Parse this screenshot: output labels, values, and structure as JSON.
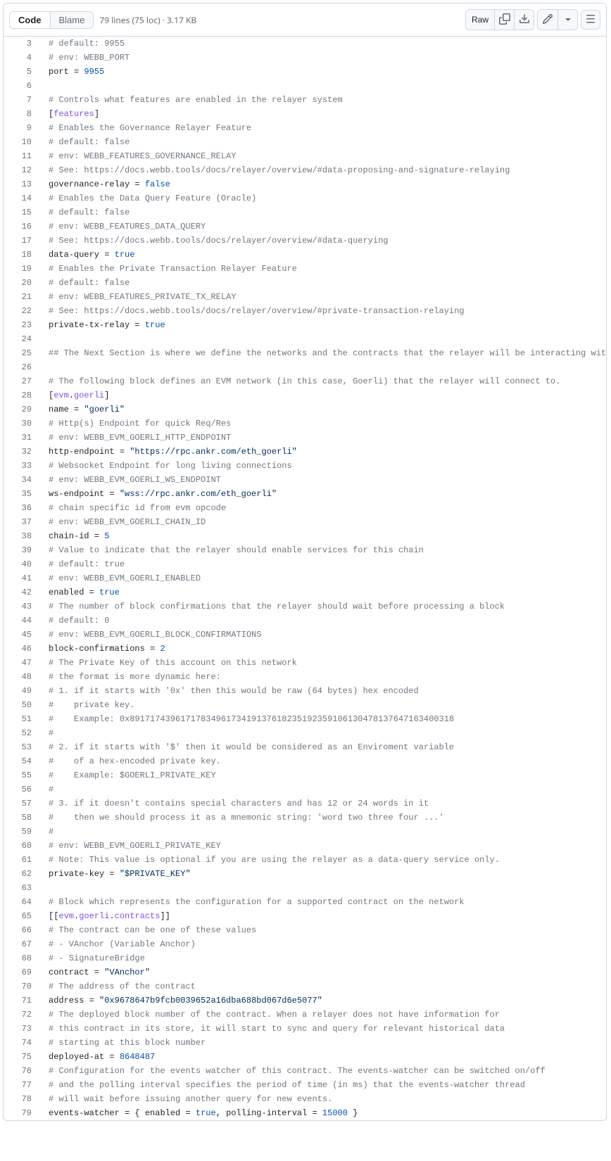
{
  "toolbar": {
    "code_tab": "Code",
    "blame_tab": "Blame",
    "meta": "79 lines (75 loc) · 3.17 KB",
    "raw_label": "Raw"
  },
  "lines": [
    {
      "n": 3,
      "t": [
        {
          "c": "c-comment",
          "s": "# default: 9955"
        }
      ]
    },
    {
      "n": 4,
      "t": [
        {
          "c": "c-comment",
          "s": "# env: WEBB_PORT"
        }
      ]
    },
    {
      "n": 5,
      "t": [
        {
          "c": "c-key",
          "s": "port"
        },
        {
          "c": "c-punct",
          "s": " = "
        },
        {
          "c": "c-num",
          "s": "9955"
        }
      ]
    },
    {
      "n": 6,
      "t": []
    },
    {
      "n": 7,
      "t": [
        {
          "c": "c-comment",
          "s": "# Controls what features are enabled in the relayer system"
        }
      ]
    },
    {
      "n": 8,
      "t": [
        {
          "c": "c-section-punct",
          "s": "["
        },
        {
          "c": "c-section-body",
          "s": "features"
        },
        {
          "c": "c-section-punct",
          "s": "]"
        }
      ]
    },
    {
      "n": 9,
      "t": [
        {
          "c": "c-comment",
          "s": "# Enables the Governance Relayer Feature"
        }
      ]
    },
    {
      "n": 10,
      "t": [
        {
          "c": "c-comment",
          "s": "# default: false"
        }
      ]
    },
    {
      "n": 11,
      "t": [
        {
          "c": "c-comment",
          "s": "# env: WEBB_FEATURES_GOVERNANCE_RELAY"
        }
      ]
    },
    {
      "n": 12,
      "t": [
        {
          "c": "c-comment",
          "s": "# See: https://docs.webb.tools/docs/relayer/overview/#data-proposing-and-signature-relaying"
        }
      ]
    },
    {
      "n": 13,
      "t": [
        {
          "c": "c-key",
          "s": "governance-relay"
        },
        {
          "c": "c-punct",
          "s": " = "
        },
        {
          "c": "c-bool",
          "s": "false"
        }
      ]
    },
    {
      "n": 14,
      "t": [
        {
          "c": "c-comment",
          "s": "# Enables the Data Query Feature (Oracle)"
        }
      ]
    },
    {
      "n": 15,
      "t": [
        {
          "c": "c-comment",
          "s": "# default: false"
        }
      ]
    },
    {
      "n": 16,
      "t": [
        {
          "c": "c-comment",
          "s": "# env: WEBB_FEATURES_DATA_QUERY"
        }
      ]
    },
    {
      "n": 17,
      "t": [
        {
          "c": "c-comment",
          "s": "# See: https://docs.webb.tools/docs/relayer/overview/#data-querying"
        }
      ]
    },
    {
      "n": 18,
      "t": [
        {
          "c": "c-key",
          "s": "data-query"
        },
        {
          "c": "c-punct",
          "s": " = "
        },
        {
          "c": "c-bool",
          "s": "true"
        }
      ]
    },
    {
      "n": 19,
      "t": [
        {
          "c": "c-comment",
          "s": "# Enables the Private Transaction Relayer Feature"
        }
      ]
    },
    {
      "n": 20,
      "t": [
        {
          "c": "c-comment",
          "s": "# default: false"
        }
      ]
    },
    {
      "n": 21,
      "t": [
        {
          "c": "c-comment",
          "s": "# env: WEBB_FEATURES_PRIVATE_TX_RELAY"
        }
      ]
    },
    {
      "n": 22,
      "t": [
        {
          "c": "c-comment",
          "s": "# See: https://docs.webb.tools/docs/relayer/overview/#private-transaction-relaying"
        }
      ]
    },
    {
      "n": 23,
      "t": [
        {
          "c": "c-key",
          "s": "private-tx-relay"
        },
        {
          "c": "c-punct",
          "s": " = "
        },
        {
          "c": "c-bool",
          "s": "true"
        }
      ]
    },
    {
      "n": 24,
      "t": []
    },
    {
      "n": 25,
      "t": [
        {
          "c": "c-comment",
          "s": "## The Next Section is where we define the networks and the contracts that the relayer will be interacting wit"
        }
      ]
    },
    {
      "n": 26,
      "t": []
    },
    {
      "n": 27,
      "t": [
        {
          "c": "c-comment",
          "s": "# The following block defines an EVM network (in this case, Goerli) that the relayer will connect to."
        }
      ]
    },
    {
      "n": 28,
      "t": [
        {
          "c": "c-section-punct",
          "s": "["
        },
        {
          "c": "c-section-body",
          "s": "evm"
        },
        {
          "c": "c-punct",
          "s": "."
        },
        {
          "c": "c-section-body",
          "s": "goerli"
        },
        {
          "c": "c-section-punct",
          "s": "]"
        }
      ]
    },
    {
      "n": 29,
      "t": [
        {
          "c": "c-key",
          "s": "name"
        },
        {
          "c": "c-punct",
          "s": " = "
        },
        {
          "c": "c-string",
          "s": "\"goerli\""
        }
      ]
    },
    {
      "n": 30,
      "t": [
        {
          "c": "c-comment",
          "s": "# Http(s) Endpoint for quick Req/Res"
        }
      ]
    },
    {
      "n": 31,
      "t": [
        {
          "c": "c-comment",
          "s": "# env: WEBB_EVM_GOERLI_HTTP_ENDPOINT"
        }
      ]
    },
    {
      "n": 32,
      "t": [
        {
          "c": "c-key",
          "s": "http-endpoint"
        },
        {
          "c": "c-punct",
          "s": " = "
        },
        {
          "c": "c-string",
          "s": "\"https://rpc.ankr.com/eth_goerli\""
        }
      ]
    },
    {
      "n": 33,
      "t": [
        {
          "c": "c-comment",
          "s": "# Websocket Endpoint for long living connections"
        }
      ]
    },
    {
      "n": 34,
      "t": [
        {
          "c": "c-comment",
          "s": "# env: WEBB_EVM_GOERLI_WS_ENDPOINT"
        }
      ]
    },
    {
      "n": 35,
      "t": [
        {
          "c": "c-key",
          "s": "ws-endpoint"
        },
        {
          "c": "c-punct",
          "s": " = "
        },
        {
          "c": "c-string",
          "s": "\"wss://rpc.ankr.com/eth_goerli\""
        }
      ]
    },
    {
      "n": 36,
      "t": [
        {
          "c": "c-comment",
          "s": "# chain specific id from evm opcode"
        }
      ]
    },
    {
      "n": 37,
      "t": [
        {
          "c": "c-comment",
          "s": "# env: WEBB_EVM_GOERLI_CHAIN_ID"
        }
      ]
    },
    {
      "n": 38,
      "t": [
        {
          "c": "c-key",
          "s": "chain-id"
        },
        {
          "c": "c-punct",
          "s": " = "
        },
        {
          "c": "c-num",
          "s": "5"
        }
      ]
    },
    {
      "n": 39,
      "t": [
        {
          "c": "c-comment",
          "s": "# Value to indicate that the relayer should enable services for this chain"
        }
      ]
    },
    {
      "n": 40,
      "t": [
        {
          "c": "c-comment",
          "s": "# default: true"
        }
      ]
    },
    {
      "n": 41,
      "t": [
        {
          "c": "c-comment",
          "s": "# env: WEBB_EVM_GOERLI_ENABLED"
        }
      ]
    },
    {
      "n": 42,
      "t": [
        {
          "c": "c-key",
          "s": "enabled"
        },
        {
          "c": "c-punct",
          "s": " = "
        },
        {
          "c": "c-bool",
          "s": "true"
        }
      ]
    },
    {
      "n": 43,
      "t": [
        {
          "c": "c-comment",
          "s": "# The number of block confirmations that the relayer should wait before processing a block"
        }
      ]
    },
    {
      "n": 44,
      "t": [
        {
          "c": "c-comment",
          "s": "# default: 0"
        }
      ]
    },
    {
      "n": 45,
      "t": [
        {
          "c": "c-comment",
          "s": "# env: WEBB_EVM_GOERLI_BLOCK_CONFIRMATIONS"
        }
      ]
    },
    {
      "n": 46,
      "t": [
        {
          "c": "c-key",
          "s": "block-confirmations"
        },
        {
          "c": "c-punct",
          "s": " = "
        },
        {
          "c": "c-num",
          "s": "2"
        }
      ]
    },
    {
      "n": 47,
      "t": [
        {
          "c": "c-comment",
          "s": "# The Private Key of this account on this network"
        }
      ]
    },
    {
      "n": 48,
      "t": [
        {
          "c": "c-comment",
          "s": "# the format is more dynamic here:"
        }
      ]
    },
    {
      "n": 49,
      "t": [
        {
          "c": "c-comment",
          "s": "# 1. if it starts with '0x' then this would be raw (64 bytes) hex encoded"
        }
      ]
    },
    {
      "n": 50,
      "t": [
        {
          "c": "c-comment",
          "s": "#    private key."
        }
      ]
    },
    {
      "n": 51,
      "t": [
        {
          "c": "c-comment",
          "s": "#    Example: 0x8917174396171783496173419137618235192359106130478137647163400318"
        }
      ]
    },
    {
      "n": 52,
      "t": [
        {
          "c": "c-comment",
          "s": "#"
        }
      ]
    },
    {
      "n": 53,
      "t": [
        {
          "c": "c-comment",
          "s": "# 2. if it starts with '$' then it would be considered as an Enviroment variable"
        }
      ]
    },
    {
      "n": 54,
      "t": [
        {
          "c": "c-comment",
          "s": "#    of a hex-encoded private key."
        }
      ]
    },
    {
      "n": 55,
      "t": [
        {
          "c": "c-comment",
          "s": "#    Example: $GOERLI_PRIVATE_KEY"
        }
      ]
    },
    {
      "n": 56,
      "t": [
        {
          "c": "c-comment",
          "s": "#"
        }
      ]
    },
    {
      "n": 57,
      "t": [
        {
          "c": "c-comment",
          "s": "# 3. if it doesn't contains special characters and has 12 or 24 words in it"
        }
      ]
    },
    {
      "n": 58,
      "t": [
        {
          "c": "c-comment",
          "s": "#    then we should process it as a mnemonic string: 'word two three four ...'"
        }
      ]
    },
    {
      "n": 59,
      "t": [
        {
          "c": "c-comment",
          "s": "#"
        }
      ]
    },
    {
      "n": 60,
      "t": [
        {
          "c": "c-comment",
          "s": "# env: WEBB_EVM_GOERLI_PRIVATE_KEY"
        }
      ]
    },
    {
      "n": 61,
      "t": [
        {
          "c": "c-comment",
          "s": "# Note: This value is optional if you are using the relayer as a data-query service only."
        }
      ]
    },
    {
      "n": 62,
      "t": [
        {
          "c": "c-key",
          "s": "private-key"
        },
        {
          "c": "c-punct",
          "s": " = "
        },
        {
          "c": "c-string",
          "s": "\"$PRIVATE_KEY\""
        }
      ]
    },
    {
      "n": 63,
      "t": []
    },
    {
      "n": 64,
      "t": [
        {
          "c": "c-comment",
          "s": "# Block which represents the configuration for a supported contract on the network"
        }
      ]
    },
    {
      "n": 65,
      "t": [
        {
          "c": "c-section-punct",
          "s": "[["
        },
        {
          "c": "c-section-body",
          "s": "evm"
        },
        {
          "c": "c-punct",
          "s": "."
        },
        {
          "c": "c-section-body",
          "s": "goerli"
        },
        {
          "c": "c-punct",
          "s": "."
        },
        {
          "c": "c-section-body",
          "s": "contracts"
        },
        {
          "c": "c-section-punct",
          "s": "]]"
        }
      ]
    },
    {
      "n": 66,
      "t": [
        {
          "c": "c-comment",
          "s": "# The contract can be one of these values"
        }
      ]
    },
    {
      "n": 67,
      "t": [
        {
          "c": "c-comment",
          "s": "# - VAnchor (Variable Anchor)"
        }
      ]
    },
    {
      "n": 68,
      "t": [
        {
          "c": "c-comment",
          "s": "# - SignatureBridge"
        }
      ]
    },
    {
      "n": 69,
      "t": [
        {
          "c": "c-key",
          "s": "contract"
        },
        {
          "c": "c-punct",
          "s": " = "
        },
        {
          "c": "c-string",
          "s": "\"VAnchor\""
        }
      ]
    },
    {
      "n": 70,
      "t": [
        {
          "c": "c-comment",
          "s": "# The address of the contract"
        }
      ]
    },
    {
      "n": 71,
      "t": [
        {
          "c": "c-key",
          "s": "address"
        },
        {
          "c": "c-punct",
          "s": " = "
        },
        {
          "c": "c-string",
          "s": "\"0x9678647b9fcb0039652a16dba688bd067d6e5077\""
        }
      ]
    },
    {
      "n": 72,
      "t": [
        {
          "c": "c-comment",
          "s": "# The deployed block number of the contract. When a relayer does not have information for"
        }
      ]
    },
    {
      "n": 73,
      "t": [
        {
          "c": "c-comment",
          "s": "# this contract in its store, it will start to sync and query for relevant historical data"
        }
      ]
    },
    {
      "n": 74,
      "t": [
        {
          "c": "c-comment",
          "s": "# starting at this block number"
        }
      ]
    },
    {
      "n": 75,
      "t": [
        {
          "c": "c-key",
          "s": "deployed-at"
        },
        {
          "c": "c-punct",
          "s": " = "
        },
        {
          "c": "c-num",
          "s": "8648487"
        }
      ]
    },
    {
      "n": 76,
      "t": [
        {
          "c": "c-comment",
          "s": "# Configuration for the events watcher of this contract. The events-watcher can be switched on/off"
        }
      ]
    },
    {
      "n": 77,
      "t": [
        {
          "c": "c-comment",
          "s": "# and the polling interval specifies the period of time (in ms) that the events-watcher thread"
        }
      ]
    },
    {
      "n": 78,
      "t": [
        {
          "c": "c-comment",
          "s": "# will wait before issuing another query for new events."
        }
      ]
    },
    {
      "n": 79,
      "t": [
        {
          "c": "c-key",
          "s": "events-watcher"
        },
        {
          "c": "c-punct",
          "s": " = { "
        },
        {
          "c": "c-key",
          "s": "enabled"
        },
        {
          "c": "c-punct",
          "s": " = "
        },
        {
          "c": "c-bool",
          "s": "true"
        },
        {
          "c": "c-punct",
          "s": ", "
        },
        {
          "c": "c-key",
          "s": "polling-interval"
        },
        {
          "c": "c-punct",
          "s": " = "
        },
        {
          "c": "c-num",
          "s": "15000"
        },
        {
          "c": "c-punct",
          "s": " }"
        }
      ]
    }
  ]
}
